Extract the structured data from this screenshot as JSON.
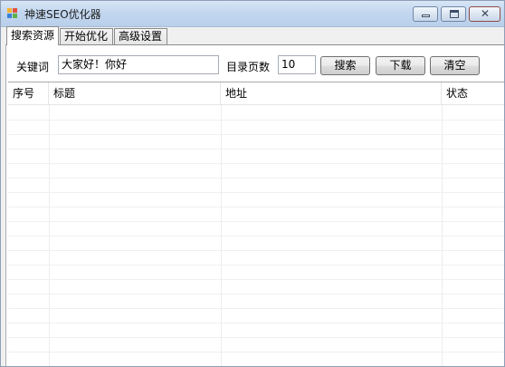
{
  "window": {
    "title": "神速SEO优化器",
    "icon": "app-grid-icon",
    "controls": {
      "minimize": "minimize-icon",
      "maximize": "maximize-icon",
      "close": "✕"
    }
  },
  "tabs": [
    {
      "label": "搜索资源",
      "active": true
    },
    {
      "label": "开始优化",
      "active": false
    },
    {
      "label": "高级设置",
      "active": false
    }
  ],
  "search": {
    "keyword_label": "关键词",
    "keyword_value": "大家好！你好",
    "pages_label": "目录页数",
    "pages_value": "10",
    "search_button": "搜索",
    "download_button": "下载",
    "clear_button": "清空"
  },
  "table": {
    "columns": [
      "序号",
      "标题",
      "地址",
      "状态"
    ],
    "rows": []
  },
  "colors": {
    "titlebar": "#c3d7ef",
    "panel": "#ffffff",
    "window_bg": "#f0f0f0"
  }
}
